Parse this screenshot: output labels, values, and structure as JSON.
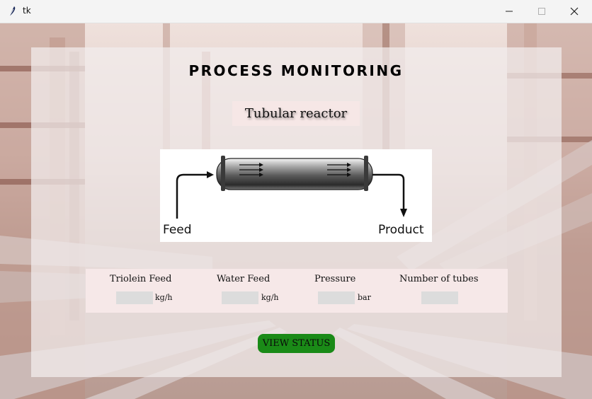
{
  "window": {
    "title": "tk",
    "icon": "feather-icon",
    "controls": [
      "minimize-icon",
      "maximize-icon",
      "close-icon"
    ]
  },
  "page": {
    "title": "PROCESS MONITORING",
    "subtitle": "Tubular reactor"
  },
  "diagram": {
    "feed_label": "Feed",
    "product_label": "Product"
  },
  "inputs": {
    "triolein": {
      "label": "Triolein Feed",
      "value": "",
      "unit": "kg/h"
    },
    "water": {
      "label": "Water Feed",
      "value": "",
      "unit": "kg/h"
    },
    "pressure": {
      "label": "Pressure",
      "value": "",
      "unit": "bar"
    },
    "tubes": {
      "label": "Number of tubes",
      "value": ""
    }
  },
  "actions": {
    "view_status_label": "VIEW STATUS"
  },
  "colors": {
    "button_bg": "#1a8a17",
    "input_bg": "#dcdcdc",
    "panel_bg": "#f2ecec",
    "subtitle_bg": "#f6e7e6"
  }
}
